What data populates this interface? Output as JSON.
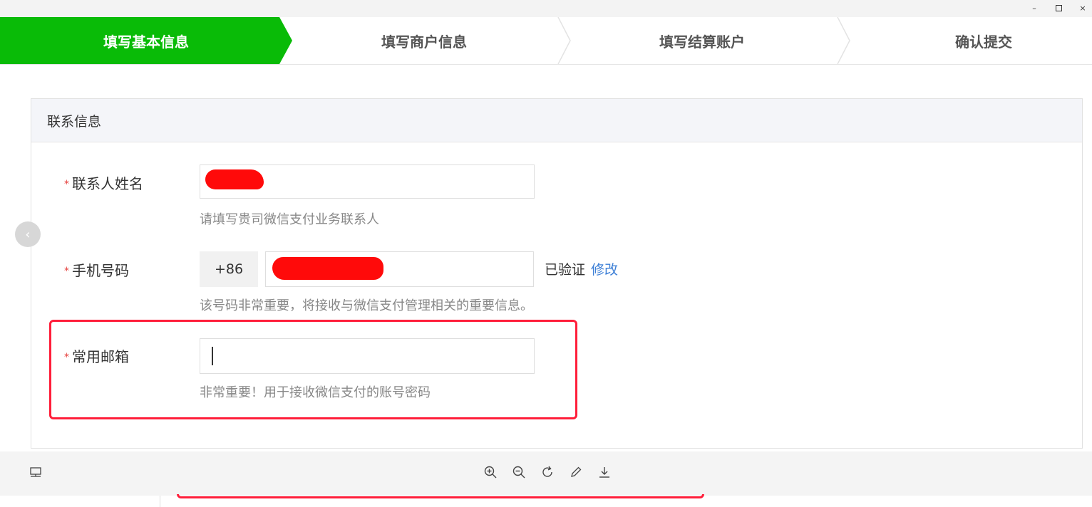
{
  "window": {
    "minimize_glyph": "–",
    "close_glyph": "×"
  },
  "steps": [
    {
      "label": "填写基本信息",
      "active": true
    },
    {
      "label": "填写商户信息",
      "active": false
    },
    {
      "label": "填写结算账户",
      "active": false
    },
    {
      "label": "确认提交",
      "active": false
    }
  ],
  "section": {
    "title": "联系信息"
  },
  "form": {
    "required_mark": "*",
    "contact_name": {
      "label": "联系人姓名",
      "hint": "请填写贵司微信支付业务联系人"
    },
    "phone": {
      "label": "手机号码",
      "prefix": "+86",
      "status": "已验证",
      "action": "修改",
      "hint": "该号码非常重要，将接收与微信支付管理相关的重要信息。"
    },
    "email": {
      "label": "常用邮箱",
      "value": "",
      "hint": "非常重要！用于接收微信支付的账号密码"
    }
  },
  "nav": {
    "prev_glyph": "‹"
  },
  "toolbar": {
    "icons": [
      "thumbnail-icon",
      "zoom-in-icon",
      "zoom-out-icon",
      "rotate-icon",
      "edit-icon",
      "download-icon"
    ]
  },
  "colors": {
    "accent": "#09bb07",
    "link": "#3d7fd6",
    "highlight": "#ff1e3a",
    "redaction": "#ff0a0a"
  }
}
